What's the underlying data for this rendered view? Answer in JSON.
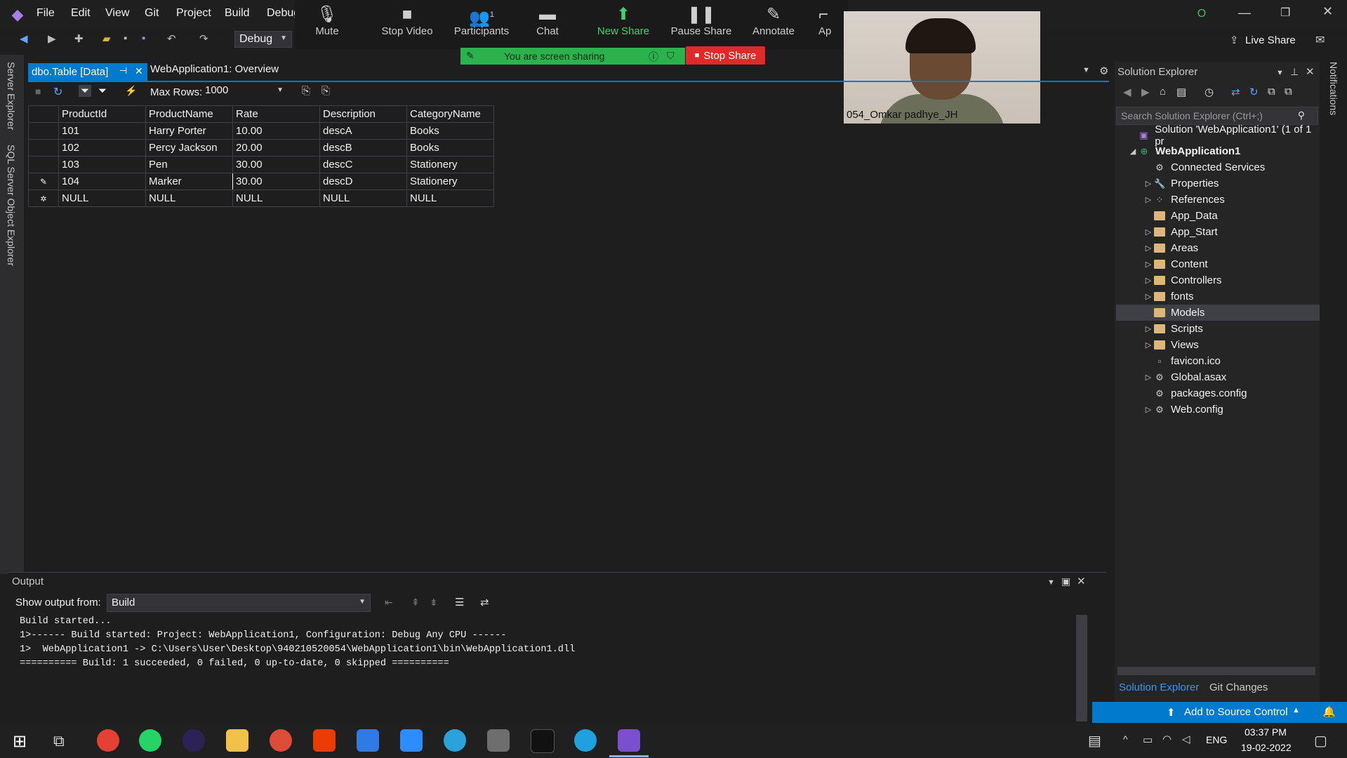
{
  "menu": {
    "items": [
      "File",
      "Edit",
      "View",
      "Git",
      "Project",
      "Build",
      "Debug"
    ]
  },
  "toolbar": {
    "config": "Debug"
  },
  "zoom": {
    "buttons": [
      "Mute",
      "Stop Video",
      "Participants",
      "Chat",
      "New Share",
      "Pause Share",
      "Annotate",
      "Ap"
    ],
    "participants_count": "1",
    "banner": "You are screen sharing",
    "stop_share": "Stop Share",
    "video_name": "054_Omkar padhye_JH"
  },
  "tabs": {
    "active": "dbo.Table [Data]",
    "other": "WebApplication1: Overview"
  },
  "grid_toolbar": {
    "max_rows_label": "Max Rows:",
    "max_rows_value": "1000"
  },
  "grid": {
    "columns": [
      "ProductId",
      "ProductName",
      "Rate",
      "Description",
      "CategoryName"
    ],
    "rows": [
      [
        "101",
        "Harry Porter",
        "10.00",
        "descA",
        "Books"
      ],
      [
        "102",
        "Percy Jackson",
        "20.00",
        "descB",
        "Books"
      ],
      [
        "103",
        "Pen",
        "30.00",
        "descC",
        "Stationery"
      ],
      [
        "104",
        "Marker",
        "30.00",
        "descD",
        "Stationery"
      ],
      [
        "NULL",
        "NULL",
        "NULL",
        "NULL",
        "NULL"
      ]
    ]
  },
  "left_strip": {
    "server_explorer": "Server Explorer",
    "sql_explorer": "SQL Server Object Explorer"
  },
  "output": {
    "title": "Output",
    "show_from_label": "Show output from:",
    "source": "Build",
    "lines": [
      "Build started...",
      "1>------ Build started: Project: WebApplication1, Configuration: Debug Any CPU ------",
      "1>  WebApplication1 -> C:\\Users\\User\\Desktop\\940210520054\\WebApplication1\\bin\\WebApplication1.dll",
      "========== Build: 1 succeeded, 0 failed, 0 up-to-date, 0 skipped =========="
    ]
  },
  "solution_explorer": {
    "title": "Solution Explorer",
    "search_placeholder": "Search Solution Explorer (Ctrl+;)",
    "solution": "Solution 'WebApplication1' (1 of 1 pr",
    "project": "WebApplication1",
    "items": [
      {
        "label": "Connected Services",
        "kind": "service",
        "expandable": false
      },
      {
        "label": "Properties",
        "kind": "wrench",
        "expandable": true
      },
      {
        "label": "References",
        "kind": "refs",
        "expandable": true
      },
      {
        "label": "App_Data",
        "kind": "folder",
        "expandable": false
      },
      {
        "label": "App_Start",
        "kind": "folder",
        "expandable": true
      },
      {
        "label": "Areas",
        "kind": "folder",
        "expandable": true
      },
      {
        "label": "Content",
        "kind": "folder",
        "expandable": true
      },
      {
        "label": "Controllers",
        "kind": "folder",
        "expandable": true
      },
      {
        "label": "fonts",
        "kind": "folder",
        "expandable": true
      },
      {
        "label": "Models",
        "kind": "folder",
        "expandable": false
      },
      {
        "label": "Scripts",
        "kind": "folder",
        "expandable": true
      },
      {
        "label": "Views",
        "kind": "folder",
        "expandable": true
      },
      {
        "label": "favicon.ico",
        "kind": "file",
        "expandable": false
      },
      {
        "label": "Global.asax",
        "kind": "file",
        "expandable": true
      },
      {
        "label": "packages.config",
        "kind": "file",
        "expandable": false
      },
      {
        "label": "Web.config",
        "kind": "file",
        "expandable": true
      }
    ],
    "bottom_tabs": [
      "Solution Explorer",
      "Git Changes"
    ]
  },
  "right_strip": {
    "notifications": "Notifications"
  },
  "titlebar": {
    "live_share": "Live Share",
    "avatar": "O"
  },
  "status": {
    "source_control": "Add to Source Control"
  },
  "taskbar": {
    "lang": "ENG",
    "time": "03:37 PM",
    "date": "19-02-2022"
  },
  "colors": {
    "accent": "#007acc",
    "zoom_green": "#2bb24c",
    "stop_red": "#e02929",
    "folder": "#dcb67a"
  }
}
